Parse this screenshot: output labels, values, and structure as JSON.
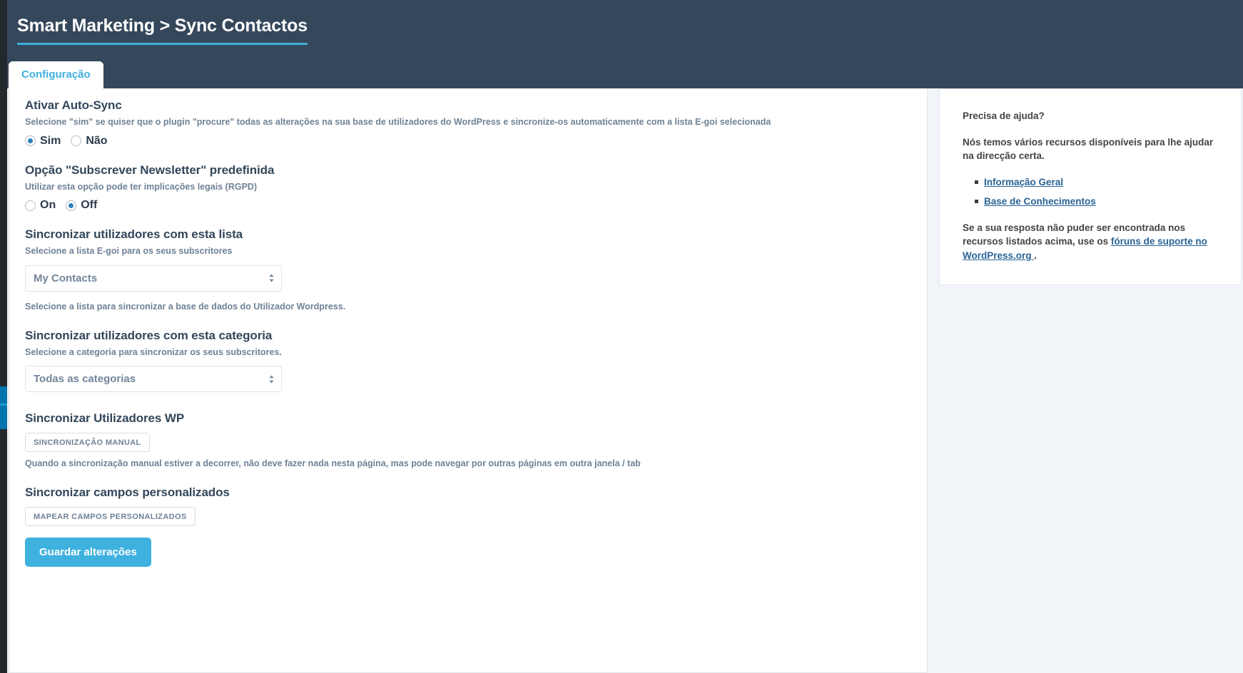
{
  "header": {
    "title": "Smart Marketing > Sync Contactos",
    "accent_color": "#3fb1df",
    "background_color": "#35475a"
  },
  "tabs": [
    {
      "label": "Configuração",
      "active": true
    }
  ],
  "form": {
    "autosync": {
      "title": "Ativar Auto-Sync",
      "description": "Selecione \"sim\" se quiser que o plugin \"procure\" todas as alterações na sua base de utilizadores do WordPress e sincronize-os automaticamente com a lista E-goi selecionada",
      "options": [
        {
          "label": "Sim",
          "checked": true
        },
        {
          "label": "Não",
          "checked": false
        }
      ]
    },
    "newsletter": {
      "title": "Opção \"Subscrever Newsletter\" predefinida",
      "description": "Utilizar esta opção pode ter implicações legais (RGPD)",
      "options": [
        {
          "label": "On",
          "checked": false
        },
        {
          "label": "Off",
          "checked": true
        }
      ]
    },
    "list": {
      "title": "Sincronizar utilizadores com esta lista",
      "description": "Selecione a lista E-goi para os seus subscritores",
      "selected": "My Contacts",
      "note": "Selecione a lista para sincronizar a base de dados do Utilizador Wordpress."
    },
    "category": {
      "title": "Sincronizar utilizadores com esta categoria",
      "description": "Selecione a categoria para sincronizar os seus subscritores.",
      "selected": "Todas as categorias"
    },
    "manual_sync": {
      "title": "Sincronizar Utilizadores WP",
      "button_label": "SINCRONIZAÇÃO MANUAL",
      "note": "Quando a sincronização manual estiver a decorrer, não deve fazer nada nesta página, mas pode navegar por outras páginas em outra janela / tab"
    },
    "custom_fields": {
      "title": "Sincronizar campos personalizados",
      "button_label": "MAPEAR CAMPOS PERSONALIZADOS"
    },
    "save_button_label": "Guardar alterações",
    "save_button_color": "#3fb1df"
  },
  "help": {
    "heading": "Precisa de ajuda?",
    "intro": "Nós temos vários recursos disponíveis para lhe ajudar na direcção certa.",
    "links": [
      {
        "label": "Informação Geral"
      },
      {
        "label": "Base de Conhecimentos"
      }
    ],
    "footer_prefix": "Se a sua resposta não puder ser encontrada nos recursos listados acima, use os ",
    "footer_link": "fóruns de suporte no WordPress.org ",
    "footer_suffix": "."
  }
}
